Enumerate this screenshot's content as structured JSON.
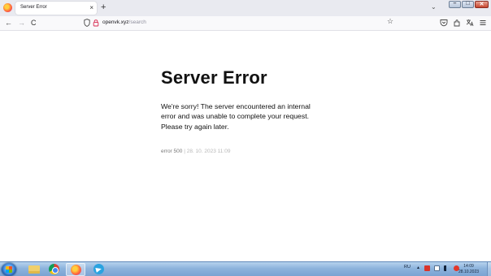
{
  "browser": {
    "tab": {
      "title": "Server Error",
      "close": "×"
    },
    "new_tab": "+",
    "tab_list": "⌄",
    "nav": {
      "back": "←",
      "forward": "→",
      "reload": "C"
    },
    "address": {
      "domain": "openvk.xyz",
      "path": "/search"
    },
    "bookmark": "☆",
    "window_controls": {
      "minimize": "–",
      "maximize": "□",
      "close": "✕"
    }
  },
  "page": {
    "title": "Server Error",
    "message": "We're sorry! The server encountered an internal error and was unable to complete your request. Please try again later.",
    "error_code": "error 500",
    "separator": "|",
    "timestamp": "28. 10. 2023 11:09"
  },
  "taskbar": {
    "language": "RU",
    "tray_arrow": "▲",
    "time": "14:09",
    "date": "28.10.2023"
  },
  "colors": {
    "chrome_bg": "#e9eaf0",
    "taskbar": "#8db3dc",
    "text": "#111111",
    "meta_text": "#777777"
  }
}
